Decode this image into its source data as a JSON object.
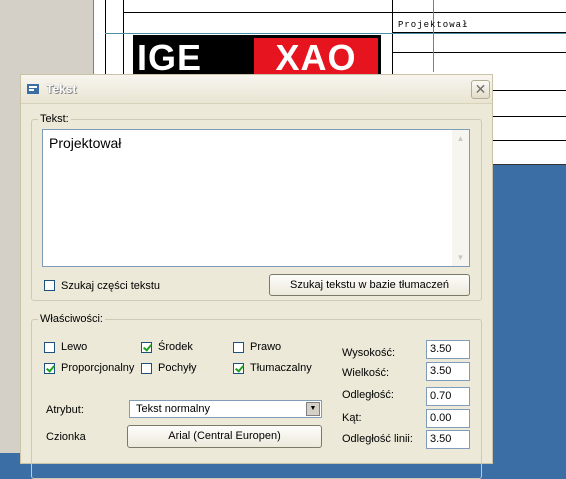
{
  "background": {
    "title_block_label": "Projektował",
    "logo_left": "IGE",
    "logo_right": "XAO"
  },
  "dialog": {
    "title": "Tekst",
    "close_glyph": "✕",
    "text_group": {
      "legend": "Tekst:",
      "value": "Projektował",
      "search_part_label": "Szukaj części tekstu",
      "search_part_checked": false,
      "search_db_button": "Szukaj tekstu w bazie tłumaczeń"
    },
    "props_group": {
      "legend": "Właściwości:",
      "checkboxes": [
        {
          "label": "Lewo",
          "checked": false
        },
        {
          "label": "Środek",
          "checked": true
        },
        {
          "label": "Prawo",
          "checked": false
        },
        {
          "label": "Proporcjonalny",
          "checked": true
        },
        {
          "label": "Pochyły",
          "checked": false
        },
        {
          "label": "Tłumaczalny",
          "checked": true
        }
      ],
      "fields": [
        {
          "label": "Wysokość:",
          "value": "3.50"
        },
        {
          "label": "Wielkość:",
          "value": "3.50"
        },
        {
          "label": "Odległość:",
          "value": "0.70"
        },
        {
          "label": "Kąt:",
          "value": "0.00"
        },
        {
          "label": "Odległość linii:",
          "value": "3.50"
        }
      ],
      "attribute_label": "Atrybut:",
      "attribute_value": "Tekst normalny",
      "font_label": "Czionka",
      "font_button": "Arial (Central Europen)"
    }
  }
}
